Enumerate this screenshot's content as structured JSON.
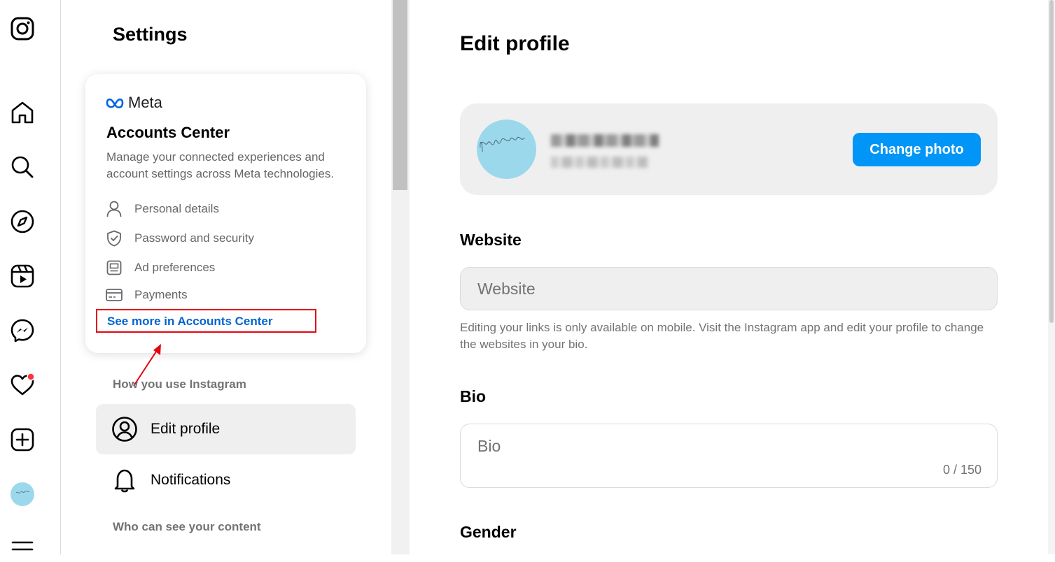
{
  "settings": {
    "title": "Settings",
    "accounts_center": {
      "brand": "Meta",
      "title": "Accounts Center",
      "description": "Manage your connected experiences and account settings across Meta technologies.",
      "items": [
        {
          "icon": "person-icon",
          "label": "Personal details"
        },
        {
          "icon": "shield-icon",
          "label": "Password and security"
        },
        {
          "icon": "ad-preferences-icon",
          "label": "Ad preferences"
        },
        {
          "icon": "credit-card-icon",
          "label": "Payments"
        }
      ],
      "see_more": "See more in Accounts Center"
    },
    "sections": [
      {
        "heading": "How you use Instagram"
      },
      {
        "heading": "Who can see your content"
      }
    ],
    "menu": [
      {
        "icon": "profile-circle-icon",
        "label": "Edit profile",
        "active": true
      },
      {
        "icon": "bell-icon",
        "label": "Notifications",
        "active": false
      }
    ]
  },
  "nav": {
    "icons": [
      "instagram-logo-icon",
      "home-icon",
      "search-icon",
      "explore-icon",
      "reels-icon",
      "messenger-icon",
      "heart-icon",
      "create-icon",
      "avatar",
      "menu-icon"
    ],
    "notification_dot_color": "#ff3040"
  },
  "main": {
    "title": "Edit profile",
    "change_photo": "Change photo",
    "website": {
      "label": "Website",
      "placeholder": "Website",
      "helper": "Editing your links is only available on mobile. Visit the Instagram app and edit your profile to change the websites in your bio."
    },
    "bio": {
      "label": "Bio",
      "placeholder": "Bio",
      "counter": "0 / 150"
    },
    "gender": {
      "label": "Gender"
    }
  },
  "colors": {
    "accent": "#0095f6",
    "link": "#0064d1",
    "highlight_box": "#e30613",
    "avatar_bg": "#9bd8ec"
  }
}
